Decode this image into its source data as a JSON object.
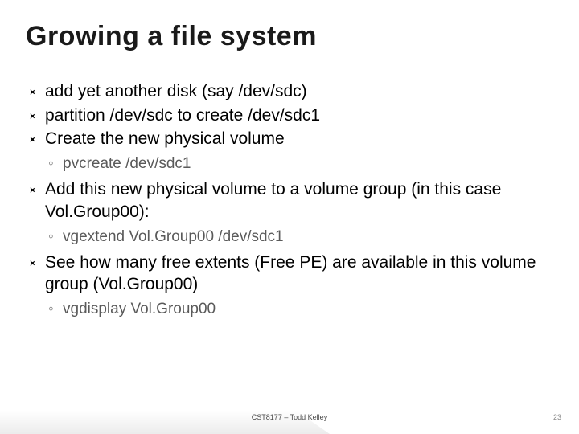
{
  "title": "Growing a file system",
  "bullets": {
    "b0": "add yet another disk (say /dev/sdc)",
    "b1": "partition /dev/sdc to create /dev/sdc1",
    "b2": "Create the new physical volume",
    "b2_sub": "pvcreate /dev/sdc1",
    "b3": "Add this new physical volume to a volume group (in this case Vol.Group00):",
    "b3_sub": "vgextend Vol.Group00 /dev/sdc1",
    "b4": "See how many free extents (Free PE) are available in this volume group (Vol.Group00)",
    "b4_sub": "vgdisplay Vol.Group00"
  },
  "footer": {
    "center": "CST8177 – Todd Kelley",
    "page": "23"
  }
}
